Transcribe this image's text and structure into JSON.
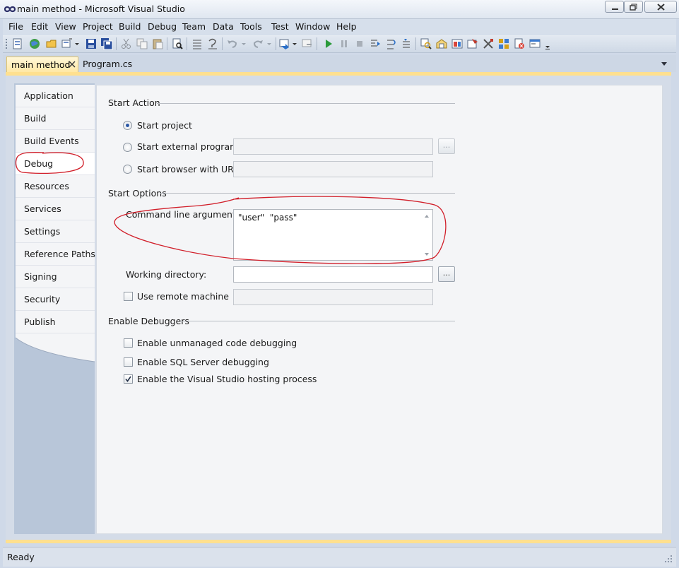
{
  "window": {
    "title": "main method - Microsoft Visual Studio"
  },
  "menu": [
    {
      "label": "File"
    },
    {
      "label": "Edit"
    },
    {
      "label": "View"
    },
    {
      "label": "Project"
    },
    {
      "label": "Build"
    },
    {
      "label": "Debug"
    },
    {
      "label": "Team"
    },
    {
      "label": "Data"
    },
    {
      "label": "Tools"
    },
    {
      "label": "Test"
    },
    {
      "label": "Window"
    },
    {
      "label": "Help"
    }
  ],
  "tabs": {
    "active": "main method",
    "other": "Program.cs"
  },
  "nav": {
    "items": [
      {
        "label": "Application"
      },
      {
        "label": "Build"
      },
      {
        "label": "Build Events"
      },
      {
        "label": "Debug"
      },
      {
        "label": "Resources"
      },
      {
        "label": "Services"
      },
      {
        "label": "Settings"
      },
      {
        "label": "Reference Paths"
      },
      {
        "label": "Signing"
      },
      {
        "label": "Security"
      },
      {
        "label": "Publish"
      }
    ],
    "selected": "Debug"
  },
  "debug": {
    "start_action": {
      "title": "Start Action",
      "start_project": "Start project",
      "start_external": "Start external program:",
      "start_browser": "Start browser with URL:",
      "external_value": "",
      "browser_value": "",
      "browse": "..."
    },
    "start_options": {
      "title": "Start Options",
      "cmd_label": "Command line arguments:",
      "cmd_value": "\"user\"  \"pass\"",
      "workdir_label": "Working directory:",
      "workdir_value": "",
      "remote_label": "Use remote machine",
      "remote_value": "",
      "browse": "..."
    },
    "enable_debuggers": {
      "title": "Enable Debuggers",
      "unmanaged": "Enable unmanaged code debugging",
      "sql": "Enable SQL Server debugging",
      "hosting": "Enable the Visual Studio hosting process"
    }
  },
  "status": {
    "text": "Ready"
  },
  "colors": {
    "active_tab": "#ffe8a6",
    "accent_bar": "#ffe08f",
    "annotation": "#d11f2a"
  }
}
